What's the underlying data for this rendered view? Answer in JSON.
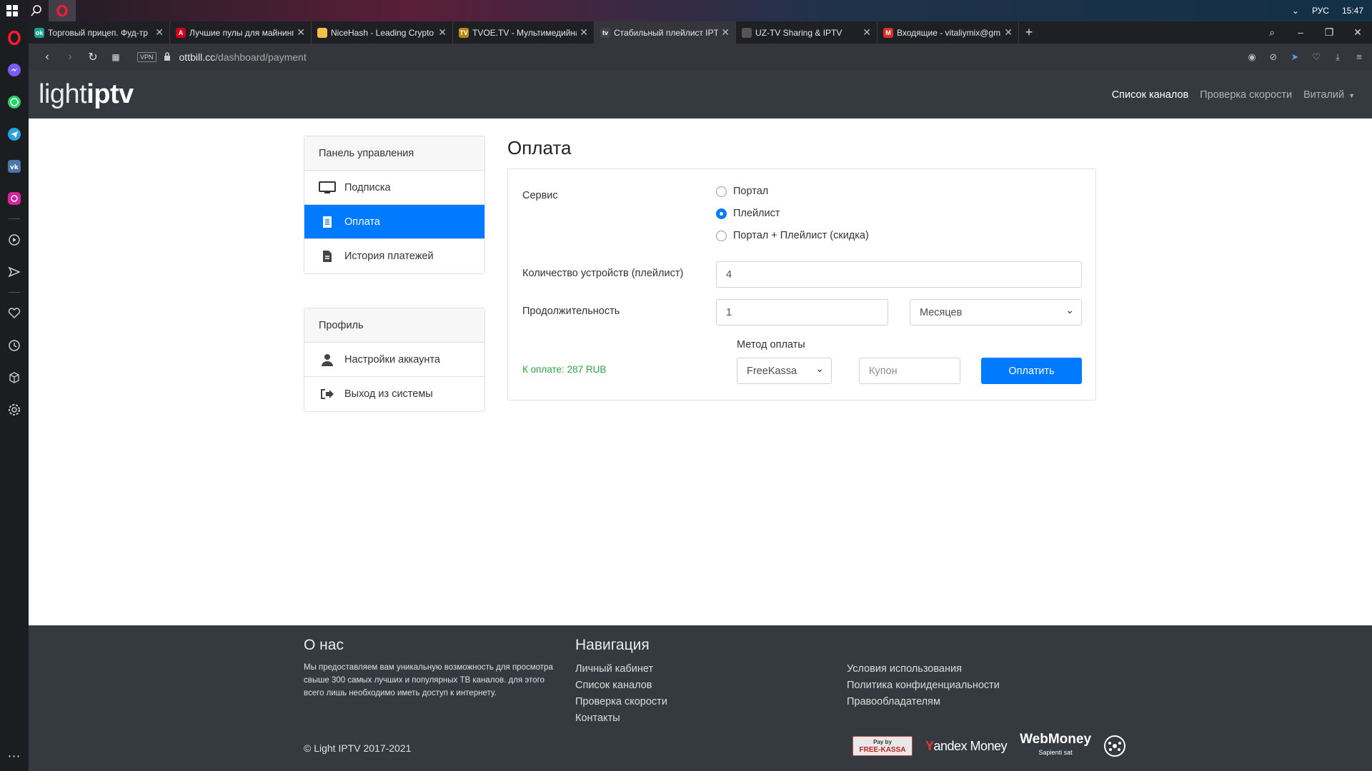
{
  "taskbar": {
    "lang": "РУС",
    "time": "15:47"
  },
  "tabs": [
    {
      "title": "Торговый прицеп. Фуд-тр",
      "fav_color": "#1a9e8f",
      "fav_text": "ok"
    },
    {
      "title": "Лучшие пулы для майнинг",
      "fav_color": "#d0021b",
      "fav_text": "A"
    },
    {
      "title": "NiceHash - Leading Crypto",
      "fav_color": "#f5c04a",
      "fav_text": ""
    },
    {
      "title": "TVOE.TV - Мультимедийна",
      "fav_color": "#b8860b",
      "fav_text": "TV"
    },
    {
      "title": "Стабильный плейлист IPTV",
      "fav_color": "#444",
      "fav_text": "tv",
      "active": true
    },
    {
      "title": "UZ-TV Sharing & IPTV",
      "fav_color": "#555",
      "fav_text": ""
    },
    {
      "title": "Входящие - vitaliymix@gm",
      "fav_color": "#d93025",
      "fav_text": "M"
    }
  ],
  "address": {
    "vpn": "VPN",
    "domain": "ottbill.cc",
    "path": "/dashboard/payment"
  },
  "site": {
    "logo_light": "light",
    "logo_iptv": "iptv",
    "nav": {
      "channels": "Список каналов",
      "speed": "Проверка скорости",
      "user": "Виталий"
    }
  },
  "dashboard_menu": {
    "header": "Панель управления",
    "items": [
      {
        "label": "Подписка",
        "icon": "monitor-icon"
      },
      {
        "label": "Оплата",
        "icon": "receipt-icon",
        "active": true
      },
      {
        "label": "История платежей",
        "icon": "document-icon"
      }
    ]
  },
  "profile_menu": {
    "header": "Профиль",
    "items": [
      {
        "label": "Настройки аккаунта",
        "icon": "user-icon"
      },
      {
        "label": "Выход из системы",
        "icon": "sign-out-icon"
      }
    ]
  },
  "payment": {
    "title": "Оплата",
    "service_label": "Сервис",
    "service_options": [
      "Портал",
      "Плейлист",
      "Портал + Плейлист (скидка)"
    ],
    "service_selected": 1,
    "devices_label": "Количество устройств (плейлист)",
    "devices_value": "4",
    "duration_label": "Продолжительность",
    "duration_value": "1",
    "duration_unit": "Месяцев",
    "method_label": "Метод оплаты",
    "method_value": "FreeKassa",
    "coupon_placeholder": "Купон",
    "pay_button": "Оплатить",
    "total": "К оплате: 287 RUB"
  },
  "footer": {
    "about_title": "О нас",
    "about_text": "Мы предоставляем вам уникальную возможность для просмотра свыше 300 самых лучших и популярных ТВ каналов. для этого всего лишь необходимо иметь доступ к интернету.",
    "nav_title": "Навигация",
    "nav_links": [
      "Личный кабинет",
      "Список каналов",
      "Проверка скорости",
      "Контакты"
    ],
    "legal_links": [
      "Условия использования",
      "Политика конфиденциальности",
      "Правообладателям"
    ],
    "copyright": "© Light IPTV 2017-2021",
    "freekassa_top": "Pay by",
    "freekassa_bottom": "FREE-KASSA",
    "yandex_y": "Y",
    "yandex_rest": "andex Money",
    "webmoney": "WebMoney",
    "webmoney_sub": "Sapienti sat"
  }
}
